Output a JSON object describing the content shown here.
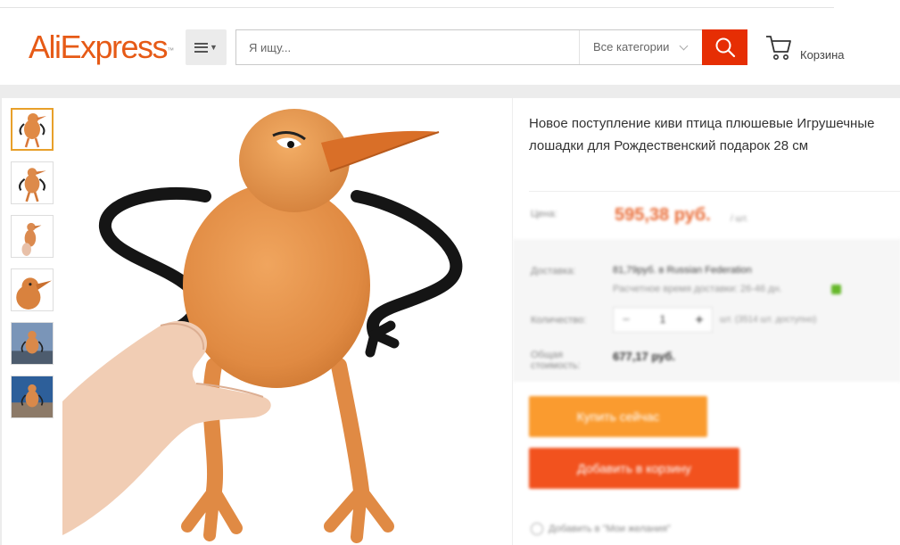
{
  "header": {
    "logo_text": "AliExpress",
    "logo_mark": "™",
    "menu_icon": "hamburger-menu-icon",
    "search": {
      "placeholder": "Я ищу...",
      "value": "",
      "category": "Все категории",
      "button_icon": "search-icon"
    },
    "cart": {
      "label": "Корзина",
      "icon": "shopping-cart-icon"
    }
  },
  "product": {
    "title": "Новое поступление киви птица плюшевые Игрушечные лошадки для Рождественский подарок 28 см",
    "thumbnails": [
      "thumbnail-1",
      "thumbnail-2",
      "thumbnail-3",
      "thumbnail-4",
      "thumbnail-5",
      "thumbnail-6"
    ],
    "active_thumbnail": 0,
    "price_label": "Цена:",
    "price": "595,38 руб.",
    "price_unit": "/ шт.",
    "shipping_label": "Доставка:",
    "shipping_cost": "81,79руб. в Russian Federation",
    "shipping_time": "Расчетное время доставки: 26-46 дн.",
    "quantity_label": "Количество:",
    "quantity": "1",
    "quantity_minus": "−",
    "quantity_plus": "+",
    "availability": "шт. (3514 шт. доступно)",
    "total_label": "Общая стоимость:",
    "total": "677,17 руб.",
    "buy_now": "Купить сейчас",
    "add_to_cart": "Добавить в корзину",
    "wishlist": "Добавить в \"Мои желания\""
  },
  "colors": {
    "brand": "#e65a16",
    "search_button": "#e62e04",
    "price": "#e96a34",
    "buy_now": "#fa9b2f",
    "add_to_cart": "#f2521e",
    "thumb_active": "#e8a02a"
  }
}
